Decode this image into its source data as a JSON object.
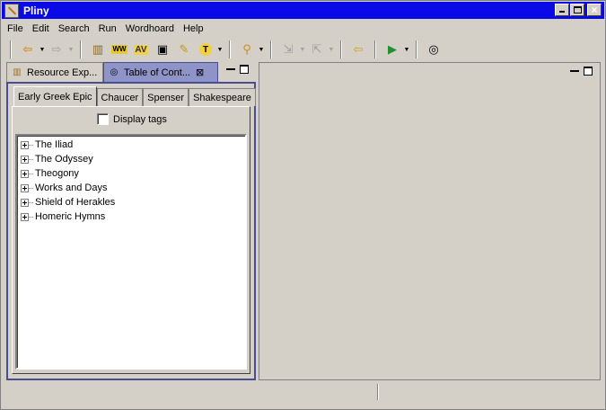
{
  "window": {
    "title": "Pliny"
  },
  "menu": [
    "File",
    "Edit",
    "Search",
    "Run",
    "Wordhoard",
    "Help"
  ],
  "toolbar": {
    "icons": [
      "back-arrow-icon",
      "forward-arrow-icon",
      "document-icon",
      "ww-icon",
      "av-icon",
      "window-icon",
      "pen-icon",
      "t-icon",
      "wand-icon",
      "next-annotation-icon",
      "previous-annotation-icon",
      "last-edit-icon",
      "run-icon",
      "globe-icon"
    ],
    "ww_text": "WW",
    "av_text": "AV",
    "t_text": "T"
  },
  "left_view": {
    "tabs": [
      {
        "label": "Resource Exp...",
        "active": false
      },
      {
        "label": "Table of Cont...",
        "active": true
      }
    ],
    "inner_tabs": [
      "Early Greek Epic",
      "Chaucer",
      "Spenser",
      "Shakespeare"
    ],
    "display_tags_label": "Display tags",
    "display_tags_checked": false,
    "tree_items": [
      "The Iliad",
      "The Odyssey",
      "Theogony",
      "Works and Days",
      "Shield of Herakles",
      "Homeric Hymns"
    ]
  },
  "colors": {
    "titlebar": "#0a0ae6",
    "active_tab": "#8e93c8",
    "chrome": "#d4d0c8"
  }
}
